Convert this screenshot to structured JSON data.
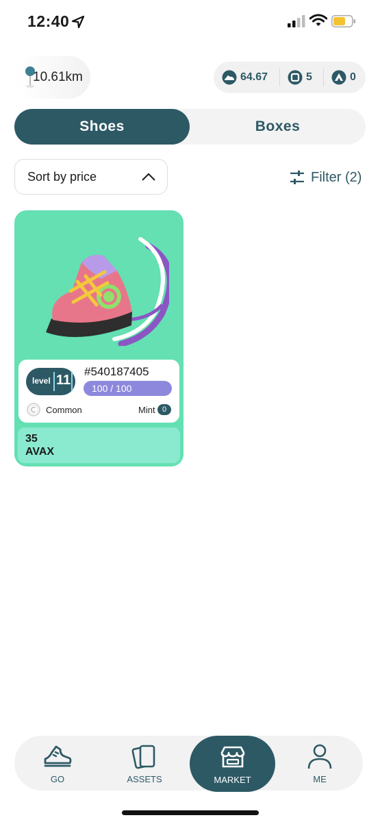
{
  "status": {
    "time": "12:40"
  },
  "header": {
    "distance": "10.61km"
  },
  "balances": [
    {
      "icon": "sneaker-token-icon",
      "value": "64.67"
    },
    {
      "icon": "box-token-icon",
      "value": "5"
    },
    {
      "icon": "avax-icon",
      "value": "0"
    }
  ],
  "segments": {
    "shoes": "Shoes",
    "boxes": "Boxes",
    "active": "Shoes"
  },
  "sort": {
    "label": "Sort by price"
  },
  "filter": {
    "label": "Filter (2)"
  },
  "listing": {
    "level_word": "level",
    "level": "11",
    "id": "#540187405",
    "durability": "100 / 100",
    "rarity": "Common",
    "mint_label": "Mint",
    "mint_count": "0",
    "price_value": "35",
    "price_currency": "AVAX",
    "card_color": "#64e0b3"
  },
  "tabs": [
    {
      "label": "GO",
      "icon": "sneaker-icon"
    },
    {
      "label": "ASSETS",
      "icon": "cards-icon"
    },
    {
      "label": "MARKET",
      "icon": "storefront-icon"
    },
    {
      "label": "ME",
      "icon": "person-icon"
    }
  ],
  "active_tab": "MARKET",
  "colors": {
    "primary": "#2d5965",
    "accent_card": "#64e0b3",
    "durability": "#8d88dc"
  }
}
